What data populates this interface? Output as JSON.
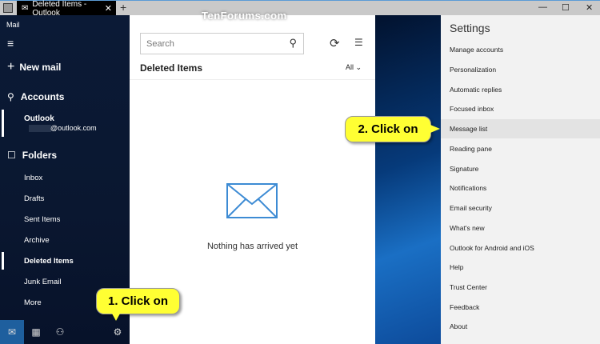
{
  "window": {
    "tab_title": "Deleted Items - Outlook",
    "watermark": "TenForums.com"
  },
  "nav": {
    "app": "Mail",
    "new_mail": "New mail",
    "accounts": "Accounts",
    "account_name": "Outlook",
    "account_email": "@outlook.com",
    "folders": "Folders",
    "folder_items": [
      "Inbox",
      "Drafts",
      "Sent Items",
      "Archive",
      "Deleted Items",
      "Junk Email",
      "More"
    ],
    "selected": "Deleted Items"
  },
  "list": {
    "search_placeholder": "Search",
    "folder_title": "Deleted Items",
    "filter": "All",
    "empty_message": "Nothing has arrived yet"
  },
  "settings": {
    "title": "Settings",
    "items": [
      "Manage accounts",
      "Personalization",
      "Automatic replies",
      "Focused inbox",
      "Message list",
      "Reading pane",
      "Signature",
      "Notifications",
      "Email security",
      "What's new",
      "Outlook for Android and iOS",
      "Help",
      "Trust Center",
      "Feedback",
      "About"
    ],
    "highlighted": "Message list"
  },
  "callouts": {
    "one": "1. Click on",
    "two": "2. Click on"
  }
}
